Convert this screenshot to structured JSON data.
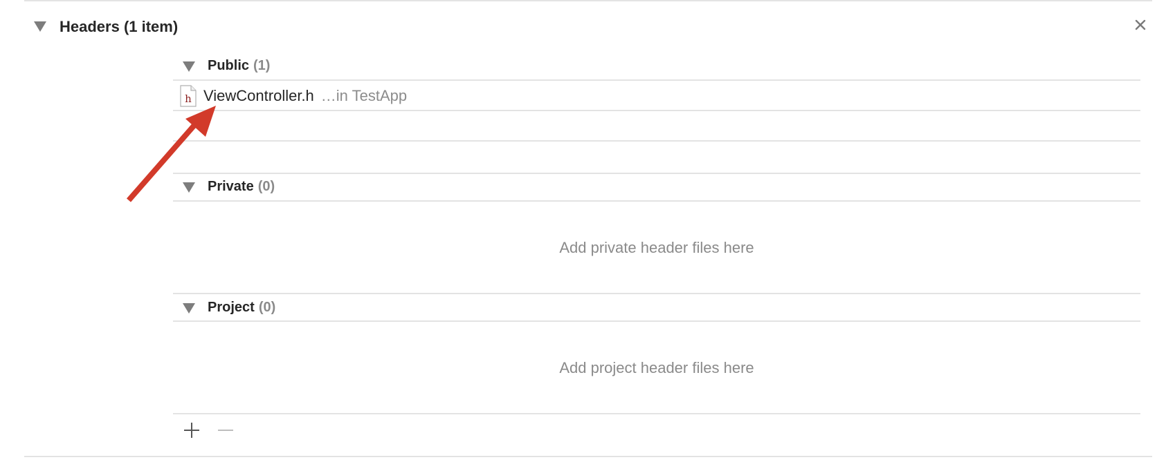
{
  "phase": {
    "title": "Headers (1 item)",
    "close_icon": "close-icon"
  },
  "sections": [
    {
      "name": "Public",
      "count": "(1)",
      "files": [
        {
          "name": "ViewController.h",
          "location": "…in TestApp",
          "icon": "header-file-icon",
          "icon_letter": "h"
        }
      ]
    },
    {
      "name": "Private",
      "count": "(0)",
      "placeholder": "Add private header files here"
    },
    {
      "name": "Project",
      "count": "(0)",
      "placeholder": "Add project header files here"
    }
  ],
  "toolbar": {
    "add_icon": "plus-icon",
    "remove_icon": "minus-icon"
  },
  "annotation": {
    "color": "#d23a2a",
    "icon": "red-arrow-annotation"
  }
}
